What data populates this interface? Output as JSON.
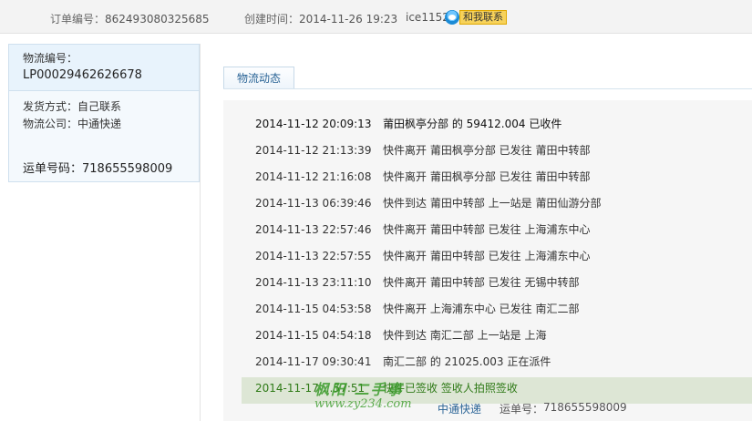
{
  "order": {
    "number_label": "订单编号：",
    "number": "862493080325685",
    "created_label": "创建时间：",
    "created": "2014-11-26 19:23",
    "seller": "ice1152",
    "contact_label": "和我联系"
  },
  "logistics": {
    "number_label": "物流编号：",
    "number": "LP00029462626678",
    "ship_method": "发货方式：自己联系",
    "company": "物流公司：中通快递",
    "waybill_label": "运单号码：",
    "waybill": "718655598009"
  },
  "tab": {
    "label": "物流动态"
  },
  "events": [
    {
      "time": "2014-11-12 20:09:13",
      "desc": "莆田枫亭分部 的 59412.004 已收件"
    },
    {
      "time": "2014-11-12 21:13:39",
      "desc": "快件离开 莆田枫亭分部 已发往 莆田中转部"
    },
    {
      "time": "2014-11-12 21:16:08",
      "desc": "快件离开 莆田枫亭分部 已发往 莆田中转部"
    },
    {
      "time": "2014-11-13 06:39:46",
      "desc": "快件到达 莆田中转部 上一站是 莆田仙游分部"
    },
    {
      "time": "2014-11-13 22:57:46",
      "desc": "快件离开 莆田中转部 已发往 上海浦东中心"
    },
    {
      "time": "2014-11-13 22:57:55",
      "desc": "快件离开 莆田中转部 已发往 上海浦东中心"
    },
    {
      "time": "2014-11-13 23:11:10",
      "desc": "快件离开 莆田中转部 已发往 无锡中转部"
    },
    {
      "time": "2014-11-15 04:53:58",
      "desc": "快件离开 上海浦东中心 已发往 南汇二部"
    },
    {
      "time": "2014-11-15 04:54:18",
      "desc": "快件到达 南汇二部 上一站是 上海"
    },
    {
      "time": "2014-11-17 09:30:41",
      "desc": "南汇二部 的 21025.003 正在派件"
    },
    {
      "time": "2014-11-17 …57:51",
      "desc": "快件已签收 签收人拍照签收"
    }
  ],
  "footer": {
    "company": "中通快递",
    "waybill_label": "运单号：",
    "waybill": "718655598009"
  },
  "watermark": {
    "main": "枫阳 二手事",
    "sub": "www.zy234.com"
  },
  "colors": {
    "accent": "#2a6496",
    "signed": "#2f7a17"
  }
}
